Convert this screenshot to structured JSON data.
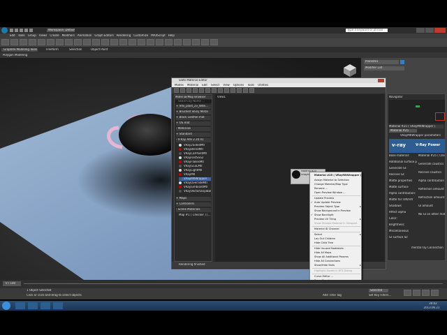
{
  "titlebar": {
    "workspace": "Workspace: Default",
    "search_placeholder": "Type a keyword or phrase"
  },
  "menu": [
    "Edit",
    "Tools",
    "Group",
    "Views",
    "Create",
    "Modifiers",
    "Animation",
    "Graph Editors",
    "Rendering",
    "Customize",
    "MAXScript",
    "Help"
  ],
  "ribbon_tabs": [
    "Graphite Modeling Tools",
    "Freeform",
    "Selection",
    "Object Paint"
  ],
  "ribbon_sub": "Polygon Modeling",
  "viewport_label": "[+] [Perspective] [Realistic]",
  "slate": {
    "title": "Slate Material Editor",
    "menu": [
      "Modes",
      "Material",
      "Edit",
      "Select",
      "View",
      "Options",
      "Tools",
      "Utilities"
    ],
    "view_tab": "View1",
    "browser_title": "Material/Map Browser",
    "browser_search": "Search by Name ...",
    "groups": [
      "+ mfx_plast_2v_Wite...",
      "+ Brushed Shiny Metal",
      "+ Black Leather.mat",
      "+ OS.mat",
      "- Materials",
      "+ Standard",
      "- V-Ray Adv 2.20.01"
    ],
    "vray_materials": [
      "VRay2SidedMtl",
      "VRayBlendMtl",
      "VRayCarPaintMtl",
      "VRayFastSSS2",
      "VRayFlakesMtl",
      "VRayGLSLMtl",
      "VRayLightMtl",
      "VRayMtl",
      "VRayMtlWrapper",
      "VRayOverrideMtl",
      "VRaySimbiontMtl",
      "VRayVectorDisplBake"
    ],
    "other_groups": [
      "+ Maps",
      "+ Controllers",
      "- Scene Materials"
    ],
    "scene_material": "Map #1 ( Checker ) [...",
    "status": "Rendering finished",
    "zoom": "100%",
    "node_title": "Material #25",
    "node_type": "VRayMtlWrapper"
  },
  "context_menu": {
    "header": "Material #25 ( VRayMtlWrapper )",
    "items": [
      "Assign Material to Selection",
      "Change Material/Map Type",
      "Rename ...",
      "Open Preview Window ...",
      "Update Preview",
      "Auto Update Preview",
      "Preview Object Type",
      "Show Background in Preview",
      "Show Backlight",
      "Preview UV Tiling",
      "Show Shaded Material in Viewport",
      "Material ID Channel",
      "Select",
      "Lay Out Children",
      "Hide Child Tree",
      "Hide Unused Nodeslots",
      "Hide All Maps",
      "Show All Additional Params",
      "Hide All Connections",
      "Show/Hide Slots",
      "Highlight Assets in ATS Dialog",
      "Curve Editor ...",
      "Dope Sheet ..."
    ]
  },
  "navigator_title": "Navigator",
  "params": {
    "header": "Material #25 ( VRayMtlWrapper )",
    "title_field": "Material #25",
    "rollout": "VRayMtlWrapper parameters",
    "logo": "v-ray",
    "logo_right": "V-Ray Power",
    "labels": [
      "Base material:",
      "Additional surface properties",
      "Generate GI:",
      "Receive GI:",
      "Matte properties",
      "Matte surface",
      "Alpha contribution:",
      "Matte for refl/refr",
      "Shadows",
      "Affect alpha",
      "Color:",
      "Brightness:",
      "Miscellaneous",
      "GI surface ID:"
    ],
    "right_labels": [
      "Material #25 ( Checker)",
      "Generate caustics",
      "Receive caustics",
      "Alpha contribution",
      "Reflection amount",
      "Refraction amount",
      "GI amount",
      "No GI on other mattes"
    ],
    "footer": "mental ray Connection"
  },
  "cmd_panel": {
    "object": "Plane001",
    "modifier_list": "Modifier List"
  },
  "timeline": {
    "frame": "0 / 100"
  },
  "status": {
    "selection": "1 Object Selected",
    "hint": "Click or click-and-drag to select objects",
    "add_time_tag": "Add Time Tag",
    "selected": "Selected",
    "set_key": "Set Key Filters..."
  },
  "taskbar": {
    "time": "20:02",
    "date": "2013.06.21"
  },
  "colors": {
    "plane": "#8aa7c8",
    "teapot": "#1a1a1a",
    "pink": "#e7b6d5",
    "vray_blue": "#2d5d92"
  }
}
